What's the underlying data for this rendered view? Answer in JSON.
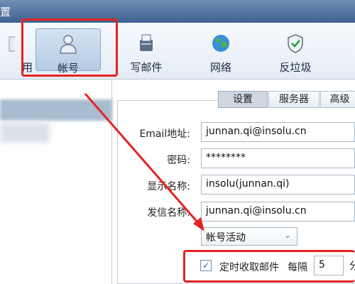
{
  "window": {
    "title": "置"
  },
  "toolbar": {
    "items": [
      {
        "label": "用"
      },
      {
        "label": "帐号"
      },
      {
        "label": "写邮件"
      },
      {
        "label": "网络"
      },
      {
        "label": "反垃圾"
      }
    ]
  },
  "tabs": [
    {
      "label": "设置"
    },
    {
      "label": "服务器"
    },
    {
      "label": "高级"
    }
  ],
  "form": {
    "email_label": "Email地址:",
    "email_value": "junnan.qi@insolu.cn",
    "password_label": "密码:",
    "password_value": "********",
    "display_name_label": "显示名称:",
    "display_name_value": "insolu(junnan.qi)",
    "sender_label": "发信名称:",
    "sender_value": "junnan.qi@insolu.cn",
    "activity_select": "帐号活动",
    "auto_fetch_label": "定时收取邮件",
    "auto_fetch_checked": true,
    "interval_label": "每隔",
    "interval_value": "5",
    "interval_unit": "分"
  },
  "colors": {
    "annotation": "#e52222",
    "accent": "#3f6190"
  }
}
